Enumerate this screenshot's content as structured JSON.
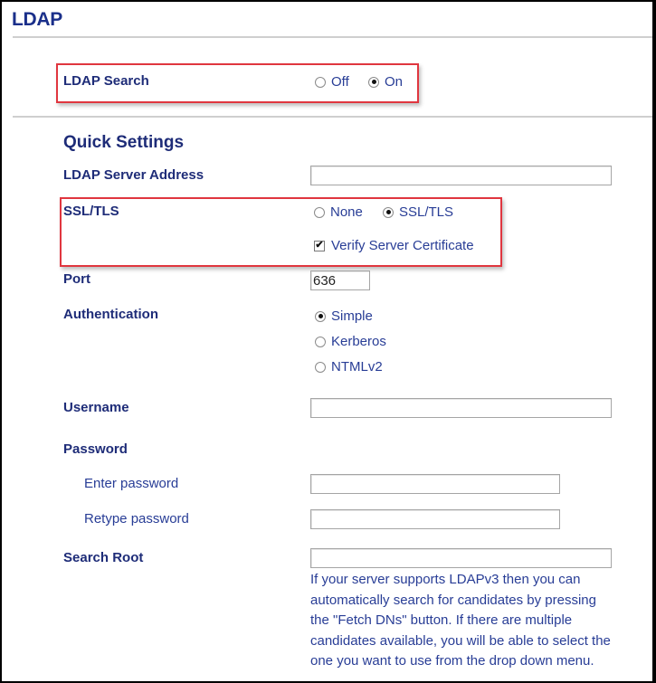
{
  "page": {
    "title": "LDAP"
  },
  "ldap_search": {
    "label": "LDAP Search",
    "options": [
      {
        "label": "Off",
        "selected": false
      },
      {
        "label": "On",
        "selected": true
      }
    ]
  },
  "quick_settings": {
    "heading": "Quick Settings",
    "server_address": {
      "label": "LDAP Server Address",
      "value": ""
    },
    "ssl_tls": {
      "label": "SSL/TLS",
      "options": [
        {
          "label": "None",
          "selected": false
        },
        {
          "label": "SSL/TLS",
          "selected": true
        }
      ],
      "verify_certificate": {
        "label": "Verify Server Certificate",
        "checked": true,
        "check_glyph": "✔"
      }
    },
    "port": {
      "label": "Port",
      "value": "636"
    },
    "authentication": {
      "label": "Authentication",
      "options": [
        {
          "label": "Simple",
          "selected": true
        },
        {
          "label": "Kerberos",
          "selected": false
        },
        {
          "label": "NTMLv2",
          "selected": false
        }
      ]
    },
    "username": {
      "label": "Username",
      "value": ""
    },
    "password": {
      "label": "Password",
      "enter_label": "Enter password",
      "enter_value": "",
      "retype_label": "Retype password",
      "retype_value": ""
    },
    "search_root": {
      "label": "Search Root",
      "value": "",
      "help_lines": [
        "If your server supports LDAPv3 then you can",
        "automatically search for candidates by pressing",
        "the \"Fetch DNs\" button. If there are multiple",
        "candidates available, you will be able to select the",
        "one you want to use from the drop down menu."
      ]
    }
  },
  "colors": {
    "heading": "#1e2c78",
    "text": "#283d96",
    "highlight": "#e0363f",
    "divider": "#cfcfcf"
  }
}
